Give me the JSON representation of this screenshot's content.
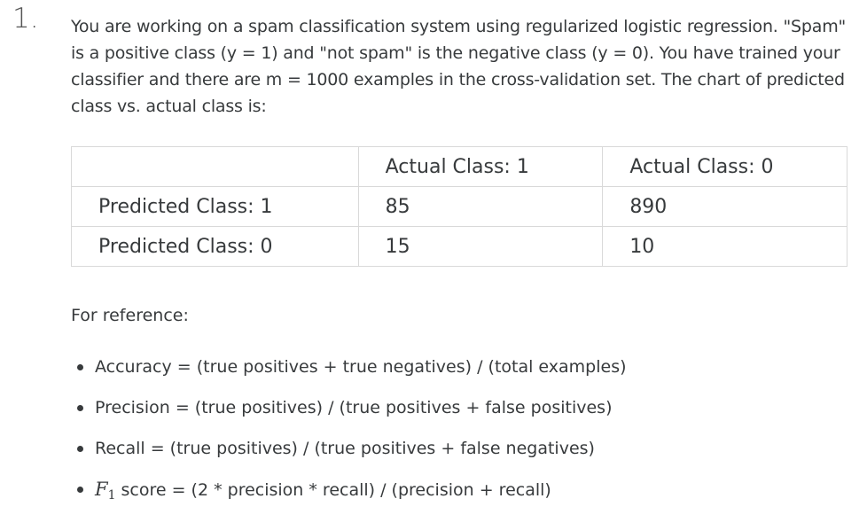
{
  "question": {
    "number": "1.",
    "text": "You are working on a spam classification system using regularized logistic regression. \"Spam\" is a positive class (y = 1) and \"not spam\" is the negative class (y = 0). You have trained your classifier and there are m = 1000 examples in the cross-validation set. The chart of predicted class vs. actual class is:"
  },
  "table": {
    "header": [
      "",
      "Actual Class: 1",
      "Actual Class: 0"
    ],
    "rows": [
      [
        "Predicted Class: 1",
        "85",
        "890"
      ],
      [
        "Predicted Class: 0",
        "15",
        "10"
      ]
    ]
  },
  "reference": {
    "label": "For reference:",
    "items": [
      "Accuracy = (true positives + true negatives) / (total examples)",
      "Precision = (true positives) / (true positives + false positives)",
      "Recall = (true positives) / (true positives + false negatives)"
    ],
    "f1": {
      "symbol": "F",
      "subscript": "1",
      "text": "score = (2 * precision * recall) / (precision + recall)"
    }
  }
}
